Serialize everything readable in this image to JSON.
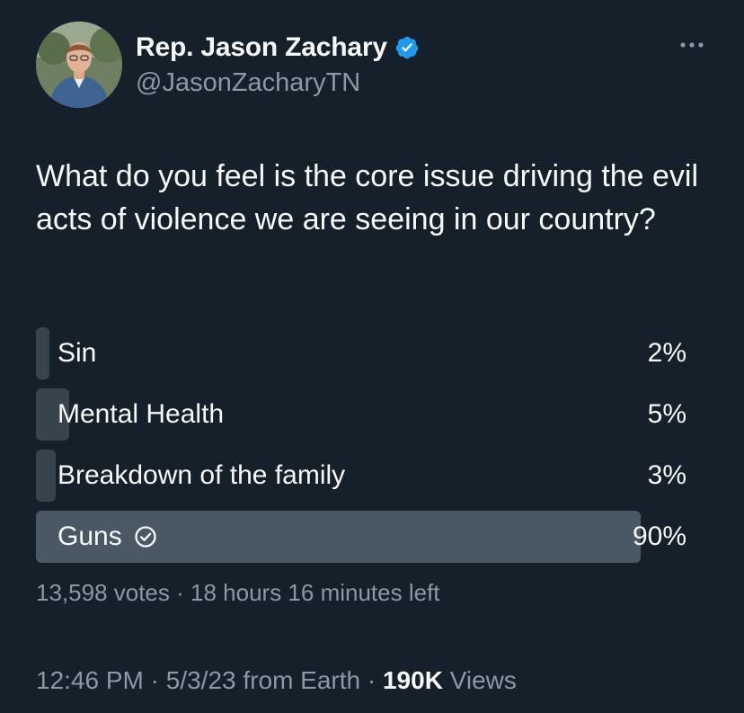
{
  "author": {
    "display_name": "Rep. Jason Zachary",
    "handle": "@JasonZacharyTN",
    "verified_icon": "verified-badge-icon",
    "avatar": "profile-photo"
  },
  "tweet": {
    "text": "What do you feel is the core issue driving the evil acts of violence we are seeing in our country?"
  },
  "poll": {
    "options": [
      {
        "label": "Sin",
        "percent_text": "2%",
        "percent": 2,
        "winner": false
      },
      {
        "label": "Mental Health",
        "percent_text": "5%",
        "percent": 5,
        "winner": false
      },
      {
        "label": "Breakdown of the family",
        "percent_text": "3%",
        "percent": 3,
        "winner": false
      },
      {
        "label": "Guns",
        "percent_text": "90%",
        "percent": 90,
        "winner": true
      }
    ],
    "votes": "13,598 votes",
    "separator": "·",
    "time_left": "18 hours 16 minutes left"
  },
  "footer": {
    "time": "12:46 PM",
    "separator": "·",
    "date": "5/3/23",
    "source": "from Earth",
    "views_count": "190K",
    "views_label": "Views"
  },
  "colors": {
    "background": "#15202b",
    "bar": "#38444d",
    "winner_bar": "#4a5866",
    "secondary_text": "#8b98a5",
    "verified": "#1d9bf0"
  }
}
